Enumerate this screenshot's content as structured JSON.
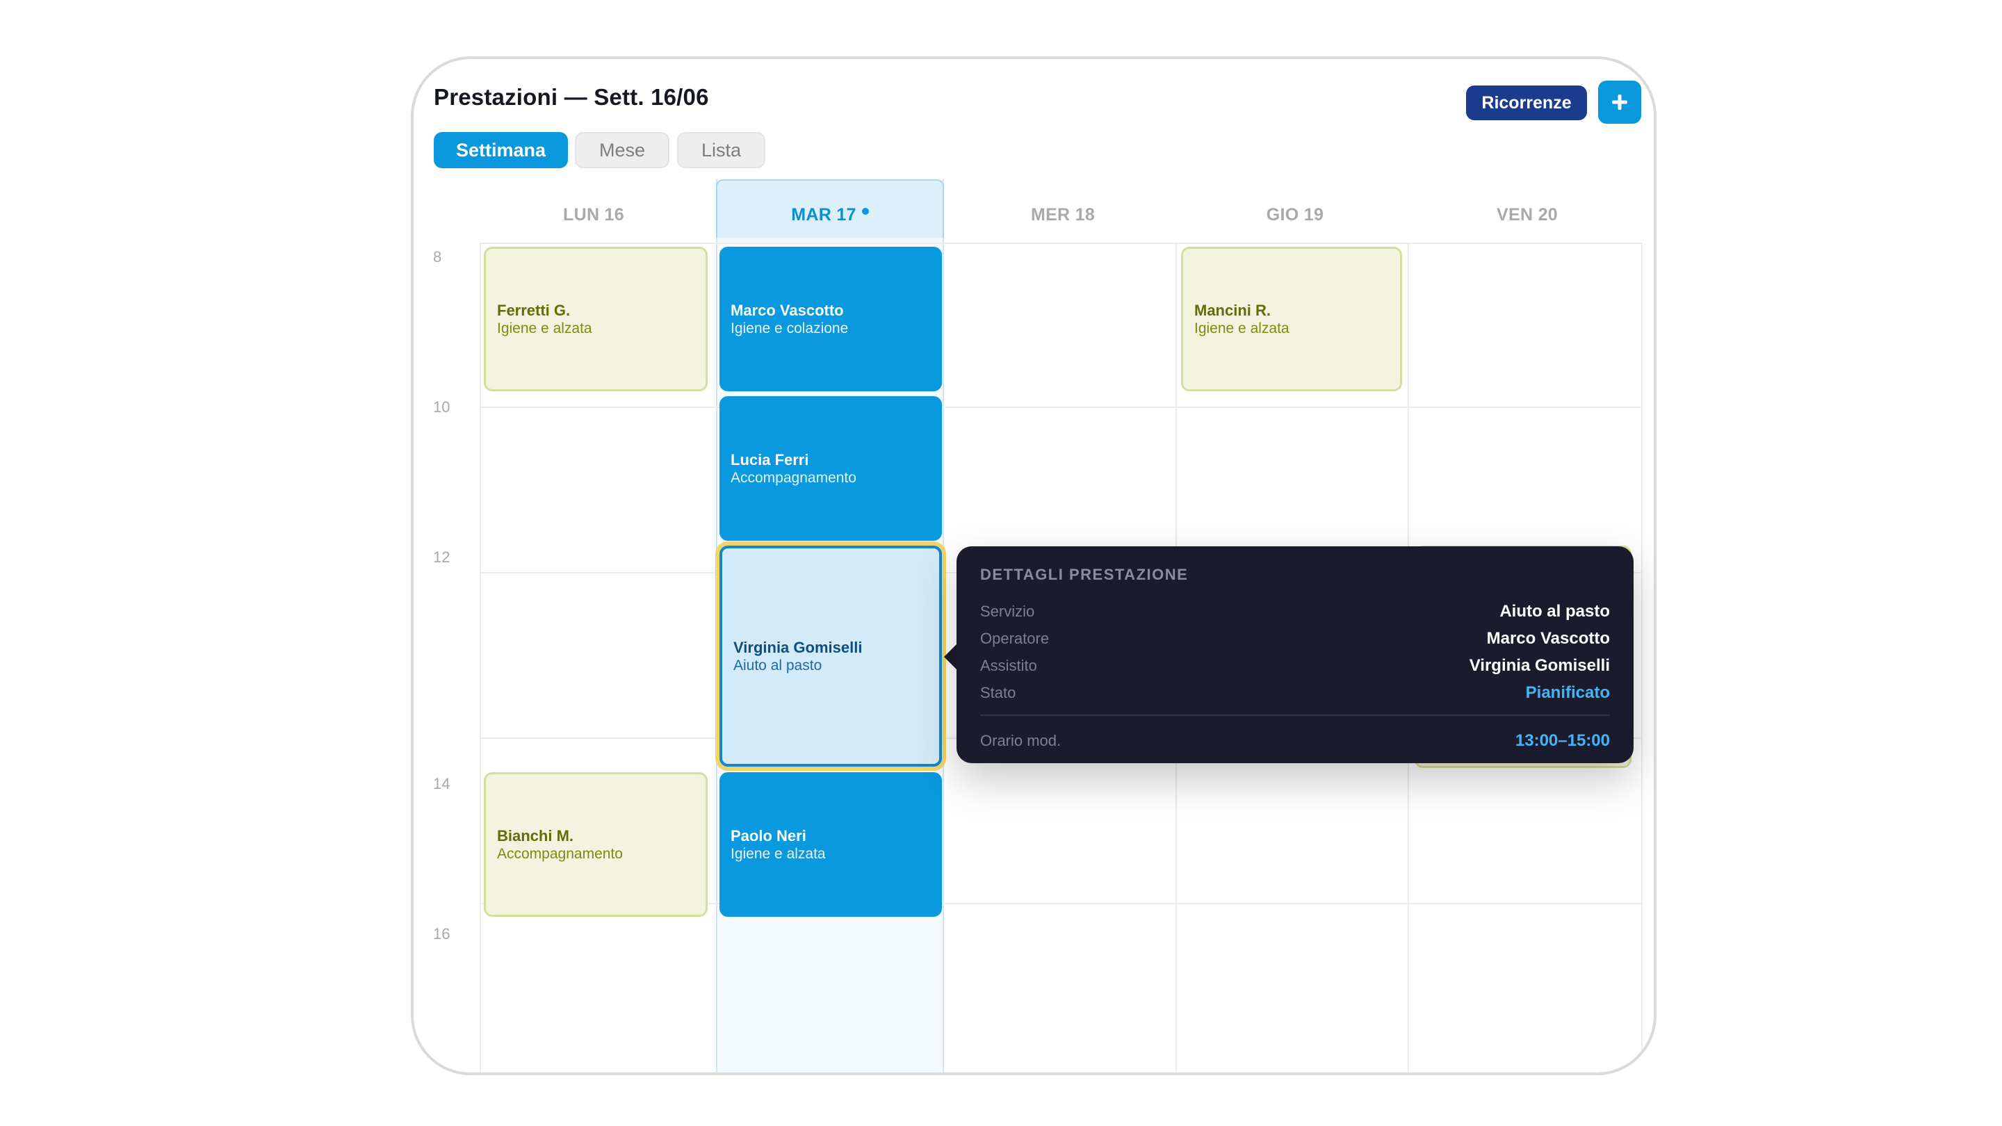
{
  "header": {
    "title": "Prestazioni — Sett. 16/06",
    "recurrences_label": "Ricorrenze",
    "add_label": "+"
  },
  "tabs": [
    {
      "label": "Settimana",
      "active": true
    },
    {
      "label": "Mese",
      "active": false
    },
    {
      "label": "Lista",
      "active": false
    }
  ],
  "days": [
    "LUN 16",
    "MAR 17",
    "MER 18",
    "GIO 19",
    "VEN 20"
  ],
  "today_index": 1,
  "hours": [
    "8",
    "10",
    "12",
    "14",
    "16"
  ],
  "events": {
    "ferretti": {
      "name": "Ferretti G.",
      "service": "Igiene e alzata"
    },
    "bianchi": {
      "name": "Bianchi M.",
      "service": "Accompagnamento"
    },
    "vascotto": {
      "name": "Marco Vascotto",
      "service": "Igiene e colazione"
    },
    "ferri": {
      "name": "Lucia Ferri",
      "service": "Accompagnamento"
    },
    "gomiselli": {
      "name": "Virginia Gomiselli",
      "service": "Aiuto al pasto"
    },
    "neri": {
      "name": "Paolo Neri",
      "service": "Igiene e alzata"
    },
    "mancini": {
      "name": "Mancini R.",
      "service": "Igiene e alzata"
    }
  },
  "tooltip": {
    "title": "DETTAGLI PRESTAZIONE",
    "rows": [
      {
        "key": "Servizio",
        "value": "Aiuto al pasto"
      },
      {
        "key": "Operatore",
        "value": "Marco Vascotto"
      },
      {
        "key": "Assistito",
        "value": "Virginia Gomiselli"
      },
      {
        "key": "Stato",
        "value": "Pianificato"
      }
    ],
    "time_key": "Orario mod.",
    "time_value": "13:00–15:00"
  },
  "colors": {
    "primary": "#0a97db",
    "navy": "#1b3b8c",
    "tooltip_bg": "#1b1b2e",
    "highlight": "#f0d56a",
    "status_accent": "#46b4f3"
  }
}
